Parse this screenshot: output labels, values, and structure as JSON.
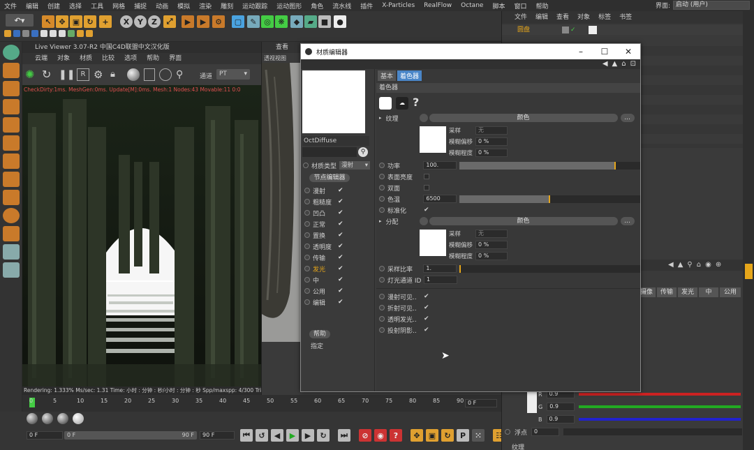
{
  "menubar": {
    "items": [
      "文件",
      "编辑",
      "创建",
      "选择",
      "工具",
      "网格",
      "捕捉",
      "动画",
      "模拟",
      "渲染",
      "雕刻",
      "运动跟踪",
      "运动图形",
      "角色",
      "流水线",
      "插件",
      "X-Particles",
      "RealFlow",
      "Octane",
      "脚本",
      "窗口",
      "帮助"
    ],
    "interface_label": "界面:",
    "interface_value": "启动 (用户)"
  },
  "live_viewer": {
    "title": "Live Viewer 3.07-R2 中国C4D联盟中文汉化版",
    "menu": [
      "云端",
      "对象",
      "材质",
      "比较",
      "选项",
      "帮助",
      "界面"
    ],
    "channel_label": "通道",
    "channel_value": "PT",
    "overlay_text": "Rendering: 1.333%  Ms/sec: 1.31  Time: 小时 : 分钟 : 秒/小时 : 分钟 : 秒  Spp/maxspp: 4/300  Tri",
    "top_info": "CheckDirty:1ms. MeshGen:0ms. Update[M]:0ms. Mesh:1 Nodes:43 Movable:11  0:0"
  },
  "viewport": {
    "menu_item": "查看",
    "tab": "透视视图"
  },
  "timeline": {
    "ticks": [
      "0",
      "5",
      "10",
      "15",
      "20",
      "25",
      "30",
      "35",
      "40",
      "45",
      "50",
      "55",
      "60",
      "65",
      "70",
      "75",
      "80",
      "85",
      "90"
    ],
    "frame_right": "0 F",
    "start_field": "0 F",
    "min_field": "0 F",
    "end_field": "90 F",
    "max_field": "90 F"
  },
  "right_panel": {
    "menu": [
      "文件",
      "编辑",
      "查看",
      "对象",
      "标签",
      "书签"
    ],
    "object_name": "圆盘",
    "bottom_tabs": [
      "摄像",
      "传输",
      "发光",
      "中",
      "公用"
    ],
    "color_rows": [
      {
        "label": "R",
        "value": "0.9"
      },
      {
        "label": "G",
        "value": "0.9"
      },
      {
        "label": "B",
        "value": "0.9"
      }
    ],
    "float_label": "浮点",
    "float_value": "0",
    "texture_label": "纹理"
  },
  "material_editor": {
    "title": "材质编辑器",
    "material_name": "OctDiffuse",
    "material_type_label": "材质类型",
    "material_type_value": "漫射",
    "node_editor_button": "节点编辑器",
    "channels": [
      {
        "label": "漫射",
        "checked": true
      },
      {
        "label": "粗糙度",
        "checked": true
      },
      {
        "label": "凹凸",
        "checked": true
      },
      {
        "label": "正常",
        "checked": true
      },
      {
        "label": "置换",
        "checked": true
      },
      {
        "label": "透明度",
        "checked": true
      },
      {
        "label": "传输",
        "checked": true
      },
      {
        "label": "发光",
        "checked": true
      },
      {
        "label": "中",
        "checked": true
      },
      {
        "label": "公用",
        "checked": true
      },
      {
        "label": "编辑",
        "checked": true
      }
    ],
    "help_button": "帮助",
    "assign_button": "指定",
    "tabs": [
      "基本",
      "着色器"
    ],
    "section": "着色器",
    "texture_row": {
      "label": "纹理",
      "button": "颜色",
      "more": "..."
    },
    "sampling1": {
      "sampling": "采样",
      "sampling_value": "无",
      "blur_offset": "模糊偏移",
      "blur_offset_value": "0 %",
      "blur_scale": "模糊程度",
      "blur_scale_value": "0 %"
    },
    "power": {
      "label": "功率",
      "value": "100.",
      "level": 0.86
    },
    "surface_brightness": {
      "label": "表面亮度"
    },
    "double_sided": {
      "label": "双面"
    },
    "temperature": {
      "label": "色温",
      "value": "6500",
      "level": 0.5
    },
    "normalize": {
      "label": "标准化"
    },
    "distribution_row": {
      "label": "分配",
      "button": "颜色",
      "more": "..."
    },
    "sampling2": {
      "sampling": "采样",
      "sampling_value": "无",
      "blur_offset": "模糊偏移",
      "blur_offset_value": "0 %",
      "blur_scale": "模糊程度",
      "blur_scale_value": "0 %"
    },
    "sample_rate": {
      "label": "采样比率",
      "value": "1."
    },
    "light_pass": {
      "label": "灯光通道 ID",
      "value": "1"
    },
    "visibility": [
      {
        "label": "漫射可见..",
        "checked": true
      },
      {
        "label": "折射可见..",
        "checked": true
      },
      {
        "label": "透明发光..",
        "checked": true
      },
      {
        "label": "投射阴影..",
        "checked": true
      }
    ]
  }
}
